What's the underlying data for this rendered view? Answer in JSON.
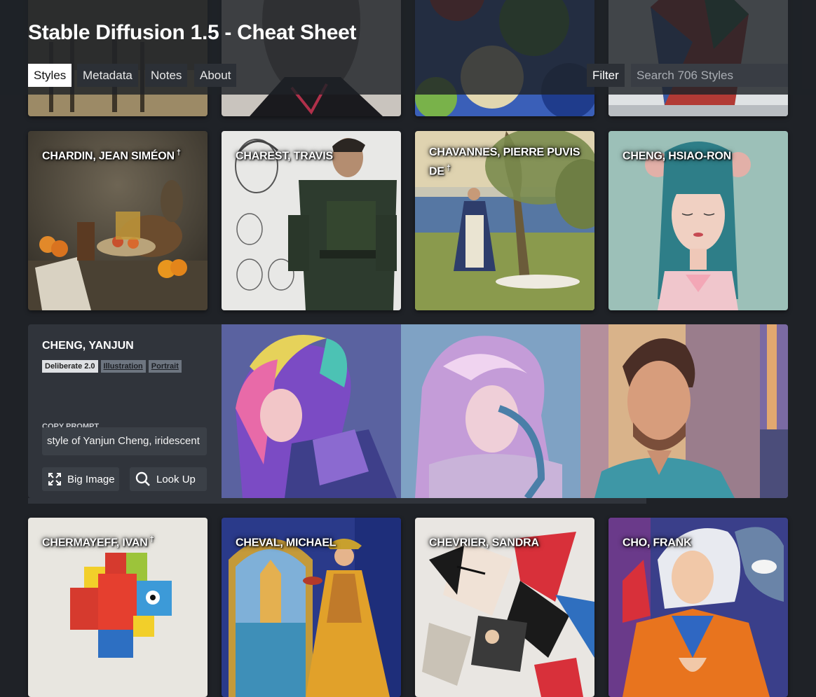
{
  "header": {
    "title": "Stable Diffusion 1.5 - Cheat Sheet",
    "tabs": [
      {
        "label": "Styles"
      },
      {
        "label": "Metadata"
      },
      {
        "label": "Notes"
      },
      {
        "label": "About"
      }
    ],
    "filter_label": "Filter",
    "search_placeholder": "Search 706 Styles",
    "search_value": ""
  },
  "row2": [
    {
      "name": "CHARDIN, JEAN SIMÉON",
      "mark": "†"
    },
    {
      "name": "CHAREST, TRAVIS",
      "mark": ""
    },
    {
      "name": "CHAVANNES, PIERRE PUVIS DE",
      "mark": "†"
    },
    {
      "name": "CHENG, HSIAO-RON",
      "mark": ""
    }
  ],
  "expanded": {
    "name": "CHENG, YANJUN",
    "tags": [
      {
        "label": "Deliberate 2.0",
        "kind": "model"
      },
      {
        "label": "Illustration",
        "kind": "category"
      },
      {
        "label": "Portrait",
        "kind": "category"
      }
    ],
    "copy_label": "COPY PROMPT",
    "prompt": "style of Yanjun Cheng, iridescent",
    "big_image_label": "Big Image",
    "look_up_label": "Look Up",
    "big_image_icon": "expand-icon",
    "look_up_icon": "search-icon"
  },
  "row3": [
    {
      "name": "CHERMAYEFF, IVAN",
      "mark": "†"
    },
    {
      "name": "CHEVAL, MICHAEL",
      "mark": ""
    },
    {
      "name": "CHEVRIER, SANDRA",
      "mark": ""
    },
    {
      "name": "CHO, FRANK",
      "mark": ""
    }
  ],
  "colors": {
    "background": "#1f2227",
    "panel": "#30343b",
    "active_tab": "#ffffff"
  }
}
